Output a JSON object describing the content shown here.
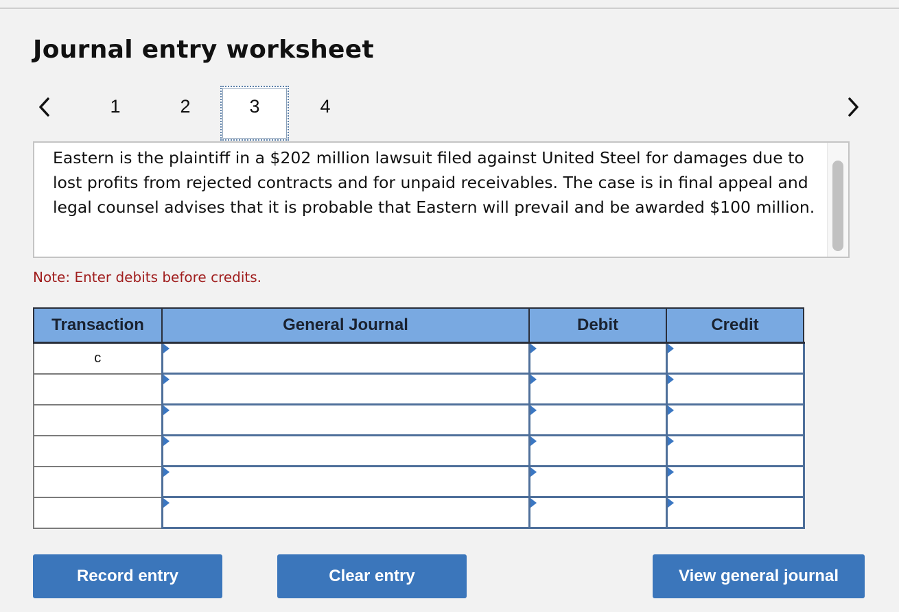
{
  "header": {
    "title": "Journal entry worksheet"
  },
  "navigation": {
    "prev_icon": "chevron-left-icon",
    "next_icon": "chevron-right-icon",
    "tabs": [
      {
        "label": "1",
        "active": false
      },
      {
        "label": "2",
        "active": false
      },
      {
        "label": "3",
        "active": true
      },
      {
        "label": "4",
        "active": false
      }
    ]
  },
  "description": {
    "text": "Eastern is the plaintiff in a $202 million lawsuit filed against United Steel for damages due to lost profits from rejected contracts and for unpaid receivables. The case is in final appeal and legal counsel advises that it is probable that Eastern will prevail and be awarded $100 million."
  },
  "note": "Note: Enter debits before credits.",
  "journal_table": {
    "columns": [
      "Transaction",
      "General Journal",
      "Debit",
      "Credit"
    ],
    "rows": [
      {
        "transaction": "c",
        "account": "",
        "debit": "",
        "credit": ""
      },
      {
        "transaction": "",
        "account": "",
        "debit": "",
        "credit": ""
      },
      {
        "transaction": "",
        "account": "",
        "debit": "",
        "credit": ""
      },
      {
        "transaction": "",
        "account": "",
        "debit": "",
        "credit": ""
      },
      {
        "transaction": "",
        "account": "",
        "debit": "",
        "credit": ""
      },
      {
        "transaction": "",
        "account": "",
        "debit": "",
        "credit": ""
      }
    ]
  },
  "buttons": {
    "record": "Record entry",
    "clear": "Clear entry",
    "view": "View general journal"
  },
  "colors": {
    "button_bg": "#3b76bb",
    "header_bg": "#79a9e1",
    "note_text": "#a01e1e",
    "cell_border": "#4e6f9a"
  }
}
